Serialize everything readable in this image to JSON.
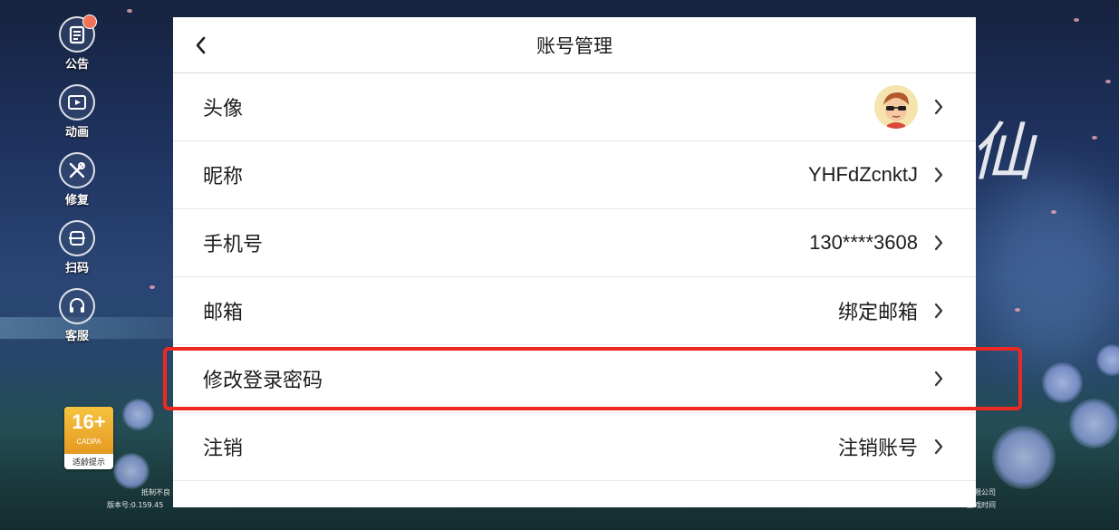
{
  "sidebar": {
    "items": [
      {
        "label": "公告",
        "icon": "notice-icon",
        "badge_color": "#f07359"
      },
      {
        "label": "动画",
        "icon": "video-icon"
      },
      {
        "label": "修复",
        "icon": "tools-icon"
      },
      {
        "label": "扫码",
        "icon": "scan-icon"
      },
      {
        "label": "客服",
        "icon": "headset-icon"
      }
    ]
  },
  "age_rating": {
    "number": "16+",
    "org": "CADPA",
    "tip": "适龄提示"
  },
  "footer": {
    "line1_left": "抵制不良",
    "line1_right": "有限公司",
    "line2_left": "版本号:0.159.45",
    "line2_right": "游戏时间"
  },
  "dialog": {
    "title": "账号管理",
    "back_icon": "chevron-left-icon",
    "rows": [
      {
        "label": "头像",
        "value": ""
      },
      {
        "label": "昵称",
        "value": "YHFdZcnktJ"
      },
      {
        "label": "手机号",
        "value": "130****3608"
      },
      {
        "label": "邮箱",
        "value": "绑定邮箱"
      },
      {
        "label": "修改登录密码",
        "value": ""
      },
      {
        "label": "注销",
        "value": "注销账号"
      }
    ]
  },
  "colors": {
    "highlight_border": "#ec2a22",
    "panel_bg": "#ffffff",
    "text": "#1c1c1c",
    "age_badge": "#f2b233"
  }
}
